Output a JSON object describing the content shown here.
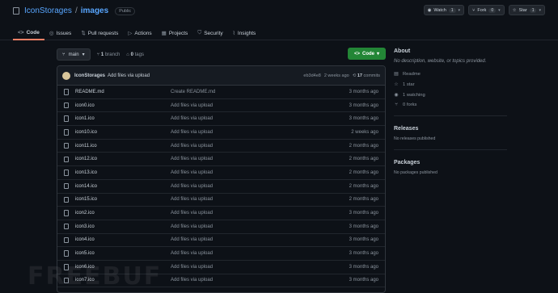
{
  "repo": {
    "owner": "IconStorages",
    "separator": "/",
    "name": "images",
    "visibility": "Public"
  },
  "actions": [
    {
      "label": "Watch",
      "count": "1",
      "icon": "eye-icon"
    },
    {
      "label": "Fork",
      "count": "0",
      "icon": "fork-icon"
    },
    {
      "label": "Star",
      "count": "1",
      "icon": "star-icon"
    }
  ],
  "tabs": [
    {
      "label": "Code",
      "icon": "code-icon"
    },
    {
      "label": "Issues",
      "icon": "issue-icon"
    },
    {
      "label": "Pull requests",
      "icon": "pull-request-icon"
    },
    {
      "label": "Actions",
      "icon": "play-icon"
    },
    {
      "label": "Projects",
      "icon": "table-icon"
    },
    {
      "label": "Security",
      "icon": "shield-icon"
    },
    {
      "label": "Insights",
      "icon": "graph-icon"
    }
  ],
  "branch": {
    "name": "main",
    "branches_count": "1",
    "branches_label": "branch",
    "tags_count": "0",
    "tags_label": "tags"
  },
  "code_button": "Code",
  "commit": {
    "author": "IconStorages",
    "message": "Add files via upload",
    "sha": "eb3d4e8",
    "age": "2 weeks ago",
    "count": "17",
    "count_label": "commits"
  },
  "files": [
    {
      "name": "README.md",
      "message": "Create README.md",
      "age": "3 months ago"
    },
    {
      "name": "icon0.ico",
      "message": "Add files via upload",
      "age": "3 months ago"
    },
    {
      "name": "icon1.ico",
      "message": "Add files via upload",
      "age": "3 months ago"
    },
    {
      "name": "icon10.ico",
      "message": "Add files via upload",
      "age": "2 weeks ago"
    },
    {
      "name": "icon11.ico",
      "message": "Add files via upload",
      "age": "2 months ago"
    },
    {
      "name": "icon12.ico",
      "message": "Add files via upload",
      "age": "2 months ago"
    },
    {
      "name": "icon13.ico",
      "message": "Add files via upload",
      "age": "2 months ago"
    },
    {
      "name": "icon14.ico",
      "message": "Add files via upload",
      "age": "2 months ago"
    },
    {
      "name": "icon15.ico",
      "message": "Add files via upload",
      "age": "2 months ago"
    },
    {
      "name": "icon2.ico",
      "message": "Add files via upload",
      "age": "3 months ago"
    },
    {
      "name": "icon3.ico",
      "message": "Add files via upload",
      "age": "3 months ago"
    },
    {
      "name": "icon4.ico",
      "message": "Add files via upload",
      "age": "3 months ago"
    },
    {
      "name": "icon5.ico",
      "message": "Add files via upload",
      "age": "3 months ago"
    },
    {
      "name": "icon6.ico",
      "message": "Add files via upload",
      "age": "3 months ago"
    },
    {
      "name": "icon7.ico",
      "message": "Add files via upload",
      "age": "3 months ago"
    }
  ],
  "about": {
    "heading": "About",
    "description": "No description, website, or topics provided.",
    "readme": "Readme",
    "stars": "1 star",
    "watching": "1 watching",
    "forks": "0 forks"
  },
  "releases": {
    "heading": "Releases",
    "text": "No releases published"
  },
  "packages": {
    "heading": "Packages",
    "text": "No packages published"
  },
  "watermark": "FREEBUF"
}
